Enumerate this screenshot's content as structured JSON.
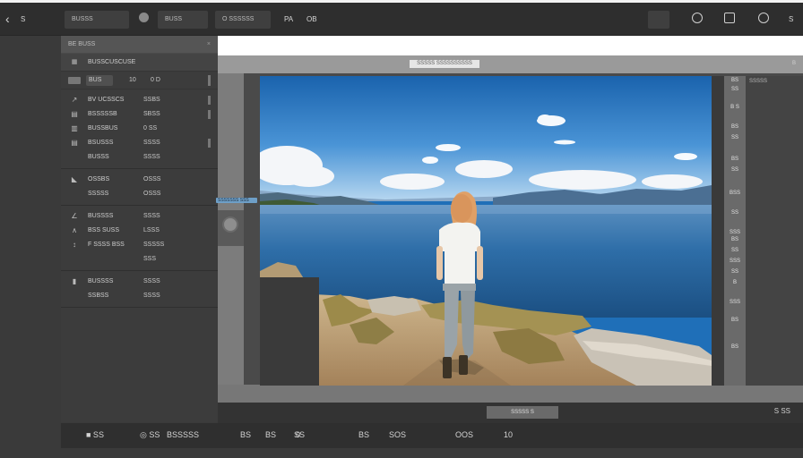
{
  "topbar": {
    "back_icon": "chevron-left-icon",
    "s_label": "S",
    "pill1": "BUSSS",
    "pill2": "BUSS",
    "pill3": "O SSSSSS",
    "pa_label": "PA",
    "ob_label": "OB",
    "right_s": "S"
  },
  "panel": {
    "header": "BE BUSS",
    "header_close": "×",
    "row1_label": "BUSSCUSCUSE",
    "row2_chip": "BUS",
    "row2_v1": "10",
    "row2_v2": "0 D",
    "groups": [
      {
        "rows": [
          {
            "icon": "↗",
            "label": "BV UCSSCS",
            "value": "SSBS"
          },
          {
            "icon": "▤",
            "label": "BSSSSSB",
            "value": "SBSS"
          },
          {
            "icon": "▥",
            "label": "BUSSBUS",
            "value": "0 SS"
          },
          {
            "icon": "▤",
            "label": "BSUSSS",
            "value": "SSSS"
          },
          {
            "icon": "",
            "label": "BUSSS",
            "value": "SSSS"
          }
        ]
      },
      {
        "rows": [
          {
            "icon": "◣",
            "label": "OSSBS",
            "value": "OSSS"
          },
          {
            "icon": "",
            "label": "SSSSS",
            "value": "OSSS"
          }
        ]
      },
      {
        "rows": [
          {
            "icon": "∠",
            "label": "BUSSSS",
            "value": "SSSS"
          },
          {
            "icon": "∧",
            "label": "BSS SUSS",
            "value": "LSSS"
          },
          {
            "icon": "↕",
            "label": "F SSSS BSS",
            "value": "SSSSS"
          },
          {
            "icon": "",
            "label": "",
            "value": "SSS"
          }
        ]
      },
      {
        "rows": [
          {
            "icon": "▮",
            "label": "BUSSSS",
            "value": "SSSS"
          },
          {
            "icon": "",
            "label": "SSBSS",
            "value": "SSSS"
          }
        ]
      }
    ]
  },
  "rowmark": "SSSSSSS SSS",
  "doc_title": "SSSSS SSSSSSSSSS",
  "doc_right": "B",
  "right_strip_labels": [
    "BS",
    "SS",
    "B S",
    "BS",
    "SS",
    "BS",
    "SS",
    "BSS",
    "SS",
    "SSS",
    "BS",
    "SS",
    "SSS",
    "SS",
    "B",
    "SSS",
    "BS",
    "BS"
  ],
  "right_panel_header": "SSSSS",
  "bottom_slab": "SSSSS S",
  "bottom_right": "S SS",
  "footer": {
    "items": [
      "■ SS",
      "◎ SS",
      "BSSSSS",
      "BS",
      "BS",
      "SS",
      "0",
      "BS",
      "SOS",
      "OOS",
      "10"
    ]
  },
  "colors": {
    "sky_top": "#1f6fb8",
    "sky_bottom": "#9bc7ea",
    "water": "#2c6aa1",
    "rock": "#c9c2b6",
    "grass": "#a49253",
    "accent": "#6e9fc7"
  }
}
